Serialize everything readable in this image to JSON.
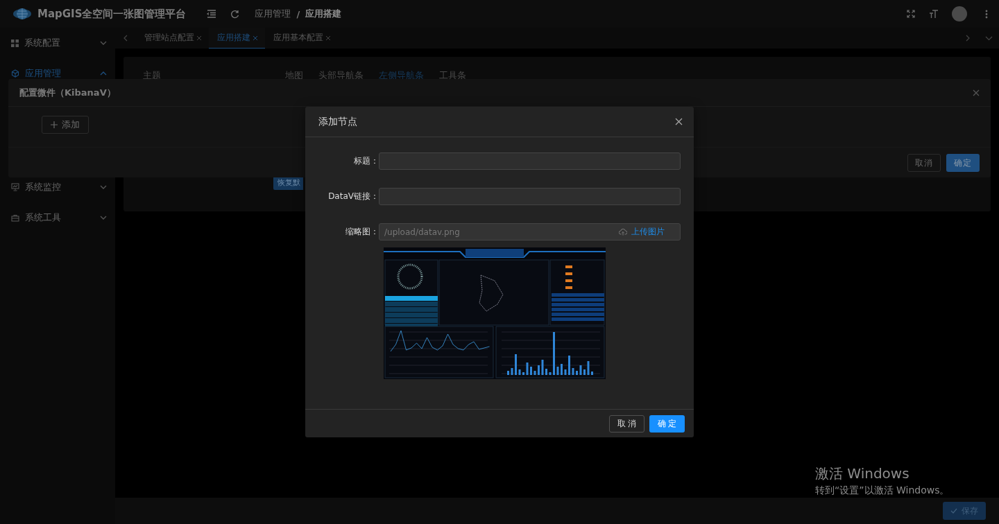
{
  "header": {
    "app_title": "MapGIS全空间一张图管理平台",
    "breadcrumb": [
      {
        "label": "应用管理",
        "current": false
      },
      {
        "label": "应用搭建",
        "current": true
      }
    ],
    "breadcrumb_separator": "/"
  },
  "sidebar": {
    "items": [
      {
        "label": "系统配置",
        "kind": "grid",
        "expanded": false,
        "selected": false
      },
      {
        "label": "应用管理",
        "kind": "cube",
        "expanded": true,
        "selected": true
      },
      {
        "label": "系统监控",
        "kind": "monitor",
        "expanded": false,
        "selected": false
      },
      {
        "label": "系统工具",
        "kind": "toolbox",
        "expanded": false,
        "selected": false
      }
    ]
  },
  "tabs": [
    {
      "label": "管理站点配置",
      "selected": false
    },
    {
      "label": "应用搭建",
      "selected": true
    },
    {
      "label": "应用基本配置",
      "selected": false
    }
  ],
  "panel": {
    "theme_label": "主题",
    "sub_tabs": [
      {
        "label": "地图",
        "selected": false
      },
      {
        "label": "头部导航条",
        "selected": false
      },
      {
        "label": "左侧导航条",
        "selected": true
      },
      {
        "label": "工具条",
        "selected": false
      }
    ],
    "restore_button": "恢复默"
  },
  "widget_dialog": {
    "title": "配置微件（KibanaV）",
    "add_button": "添加",
    "cancel_button": "取消",
    "ok_button": "确定"
  },
  "node_dialog": {
    "title": "添加节点",
    "fields": [
      {
        "label": "标题：",
        "kind": "text"
      },
      {
        "label": "DataV链接：",
        "kind": "text"
      },
      {
        "label": "缩略图：",
        "kind": "upload",
        "placeholder": "/upload/datav.png",
        "action": "上传图片"
      }
    ],
    "cancel_button": "取 消",
    "ok_button": "确 定"
  },
  "footer": {
    "save_button": "保存"
  },
  "watermark": {
    "title": "激活 Windows",
    "subtitle": "转到“设置”以激活 Windows。"
  }
}
